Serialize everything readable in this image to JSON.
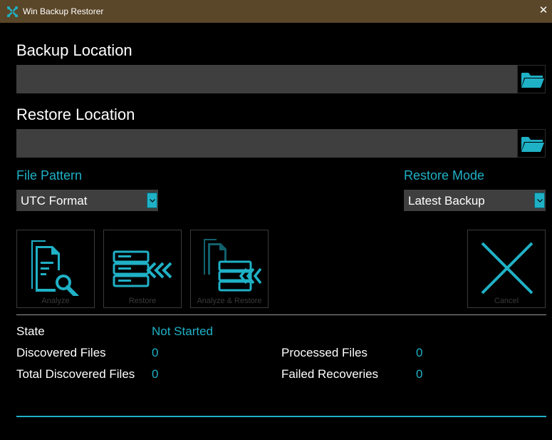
{
  "window": {
    "title": "Win Backup Restorer",
    "close_glyph": "✕"
  },
  "backup": {
    "label": "Backup Location",
    "value": ""
  },
  "restore": {
    "label": "Restore Location",
    "value": ""
  },
  "file_pattern": {
    "label": "File Pattern",
    "selected": "UTC Format"
  },
  "restore_mode": {
    "label": "Restore Mode",
    "selected": "Latest Backup"
  },
  "actions": {
    "analyze": "Analyze",
    "restore": "Restore",
    "analyze_restore": "Analyze & Restore",
    "cancel": "Cancel"
  },
  "stats": {
    "state_label": "State",
    "state_value": "Not Started",
    "discovered_label": "Discovered Files",
    "discovered_value": "0",
    "total_discovered_label": "Total Discovered Files",
    "total_discovered_value": "0",
    "processed_label": "Processed Files",
    "processed_value": "0",
    "failed_label": "Failed Recoveries",
    "failed_value": "0"
  },
  "progress_fraction": 0,
  "colors": {
    "accent": "#1fb1c6",
    "titlebar": "#5a4628",
    "field": "#3f3f3f",
    "disabled": "#3a3a3a"
  },
  "icons": {
    "app": "app-logo-icon",
    "browse": "folder-open-icon",
    "dropdown": "chevron-down-icon",
    "analyze": "document-search-icon",
    "restore": "server-restore-icon",
    "analyze_restore": "documents-restore-icon",
    "cancel": "cancel-x-icon"
  }
}
